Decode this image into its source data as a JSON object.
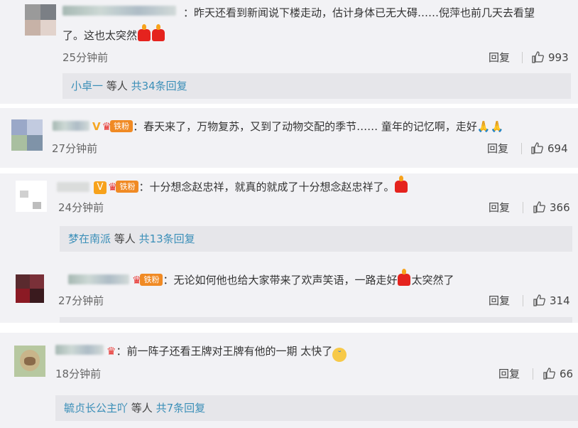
{
  "comments": [
    {
      "text": "：昨天还看到新闻说下楼走动，估计身体已无大碍……倪萍也前几天去看望",
      "text2": "了。这也太突然",
      "time": "25分钟前",
      "reply_label": "回复",
      "likes": "993",
      "replies": {
        "user": "小卓一",
        "mid": "等人",
        "count": "共34条回复"
      }
    },
    {
      "text": "：春天来了，万物复苏，又到了动物交配的季节…… 童年的记忆啊，走好",
      "time": "27分钟前",
      "reply_label": "回复",
      "likes": "694",
      "fan_badge": "铁粉",
      "verified": "V"
    },
    {
      "text": "：十分想念赵忠祥，就真的就成了十分想念赵忠祥了。",
      "time": "24分钟前",
      "reply_label": "回复",
      "likes": "366",
      "fan_badge": "铁粉",
      "verified": "V",
      "replies": {
        "user": "梦在南派",
        "mid": "等人",
        "count": "共13条回复"
      }
    },
    {
      "text": "：无论如何他也给大家带来了欢声笑语，一路走好",
      "text2": "太突然了",
      "time": "27分钟前",
      "reply_label": "回复",
      "likes": "314",
      "fan_badge": "铁粉"
    },
    {
      "text": "：前一阵子还看王牌对王牌有他的一期 太快了",
      "time": "18分钟前",
      "reply_label": "回复",
      "likes": "66",
      "replies": {
        "user": "毓贞长公主吖",
        "mid": "等人",
        "count": "共7条回复"
      }
    }
  ],
  "icons": {
    "like": "thumbs-up-icon",
    "candle": "candle-emoji-icon",
    "pray": "praying-hands-icon",
    "cry": "crying-face-icon",
    "crown": "crown-icon"
  },
  "colors": {
    "panel_bg": "#f2f2f5",
    "reply_bar_bg": "#e6e6ea",
    "link_blue": "#3b8fb8",
    "badge_orange": "#f08a24"
  }
}
